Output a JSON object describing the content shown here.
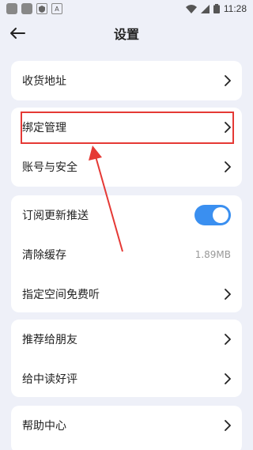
{
  "status_bar": {
    "time": "11:28",
    "notification_letter": "A",
    "icons": [
      "app-icon",
      "app-icon",
      "shield-icon",
      "text-icon",
      "wifi-icon",
      "signal-icon",
      "battery-icon"
    ]
  },
  "header": {
    "title": "设置",
    "back_icon": "arrow-left-icon"
  },
  "sections": {
    "address": {
      "label": "收货地址"
    },
    "binding": {
      "label": "绑定管理"
    },
    "account": {
      "label": "账号与安全"
    },
    "subscribe": {
      "label": "订阅更新推送",
      "enabled": true
    },
    "cache": {
      "label": "清除缓存",
      "value": "1.89MB"
    },
    "free_listen": {
      "label": "指定空间免费听"
    },
    "recommend": {
      "label": "推荐给朋友"
    },
    "review": {
      "label": "给中读好评"
    },
    "help": {
      "label": "帮助中心"
    }
  },
  "colors": {
    "background": "#eef0f8",
    "card": "#ffffff",
    "accent": "#3a8ff0",
    "annotation": "#e53935"
  }
}
